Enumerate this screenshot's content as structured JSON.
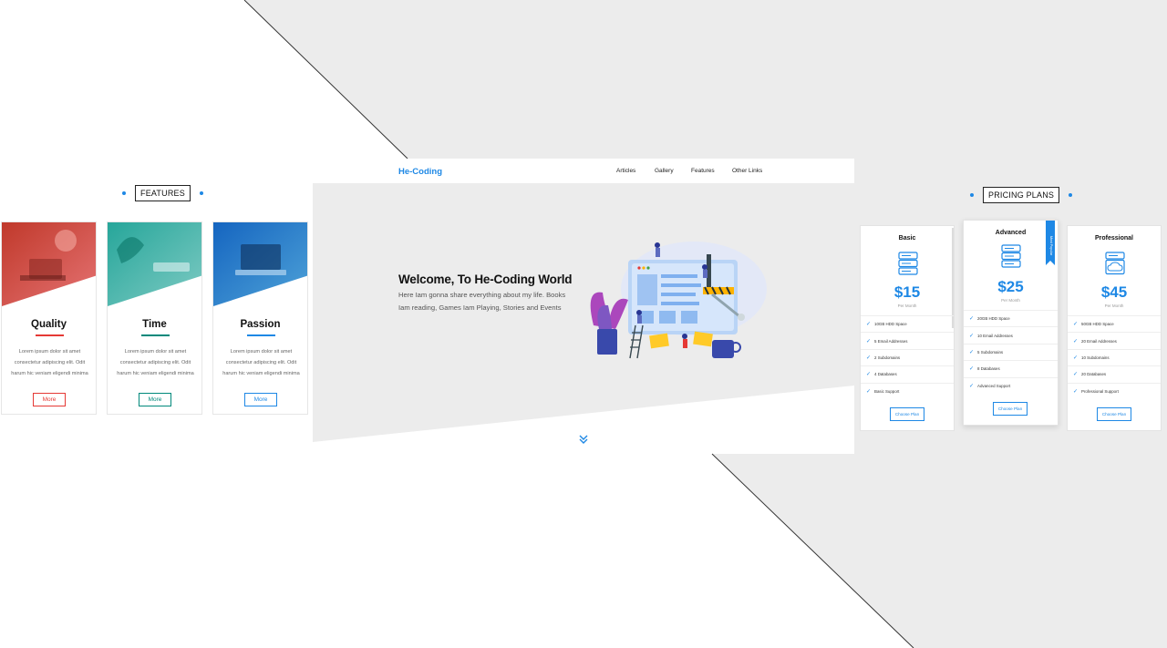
{
  "colors": {
    "accent": "#1e88e5",
    "red": "#e53935",
    "teal": "#00897b",
    "bg_gray": "#ececec"
  },
  "features": {
    "heading": "FEATURES",
    "cards": [
      {
        "title": "Quality",
        "text": "Lorem ipsum dolor sit amet consectetur adipiscing elit. Odit harum hic veniam eligendi minima",
        "button": "More",
        "color": "#e53935"
      },
      {
        "title": "Time",
        "text": "Lorem ipsum dolor sit amet consectetur adipiscing elit. Odit harum hic veniam eligendi minima",
        "button": "More",
        "color": "#00897b"
      },
      {
        "title": "Passion",
        "text": "Lorem ipsum dolor sit amet consectetur adipiscing elit. Odit harum hic veniam eligendi minima",
        "button": "More",
        "color": "#1e88e5"
      }
    ]
  },
  "hero": {
    "brand": "He-Coding",
    "nav": [
      "Articles",
      "Gallery",
      "Features",
      "Other Links"
    ],
    "title": "Welcome, To He-Coding World",
    "subtitle": "Here Iam gonna share everything about my life. Books Iam reading, Games Iam Playing, Stories and Events",
    "scroll_icon": "double-chevron-down-icon"
  },
  "pricing": {
    "heading": "PRICING PLANS",
    "plans": [
      {
        "name": "Basic",
        "price": "$15",
        "per": "Per Month",
        "features": [
          "10GB HDD Space",
          "5 Email Addresses",
          "2 Subdomains",
          "4 Databases",
          "Basic Support"
        ],
        "button": "Choose Plan"
      },
      {
        "name": "Advanced",
        "price": "$25",
        "per": "Per Month",
        "features": [
          "20GB HDD Space",
          "10 Email Addresses",
          "5 Subdomains",
          "8 Databases",
          "Advanced Support"
        ],
        "button": "Choose Plan",
        "ribbon": "Most Popular"
      },
      {
        "name": "Professional",
        "price": "$45",
        "per": "Per Month",
        "features": [
          "50GB HDD Space",
          "20 Email Addresses",
          "10 Subdomains",
          "20 Databases",
          "Professional Support"
        ],
        "button": "Choose Plan"
      }
    ]
  }
}
